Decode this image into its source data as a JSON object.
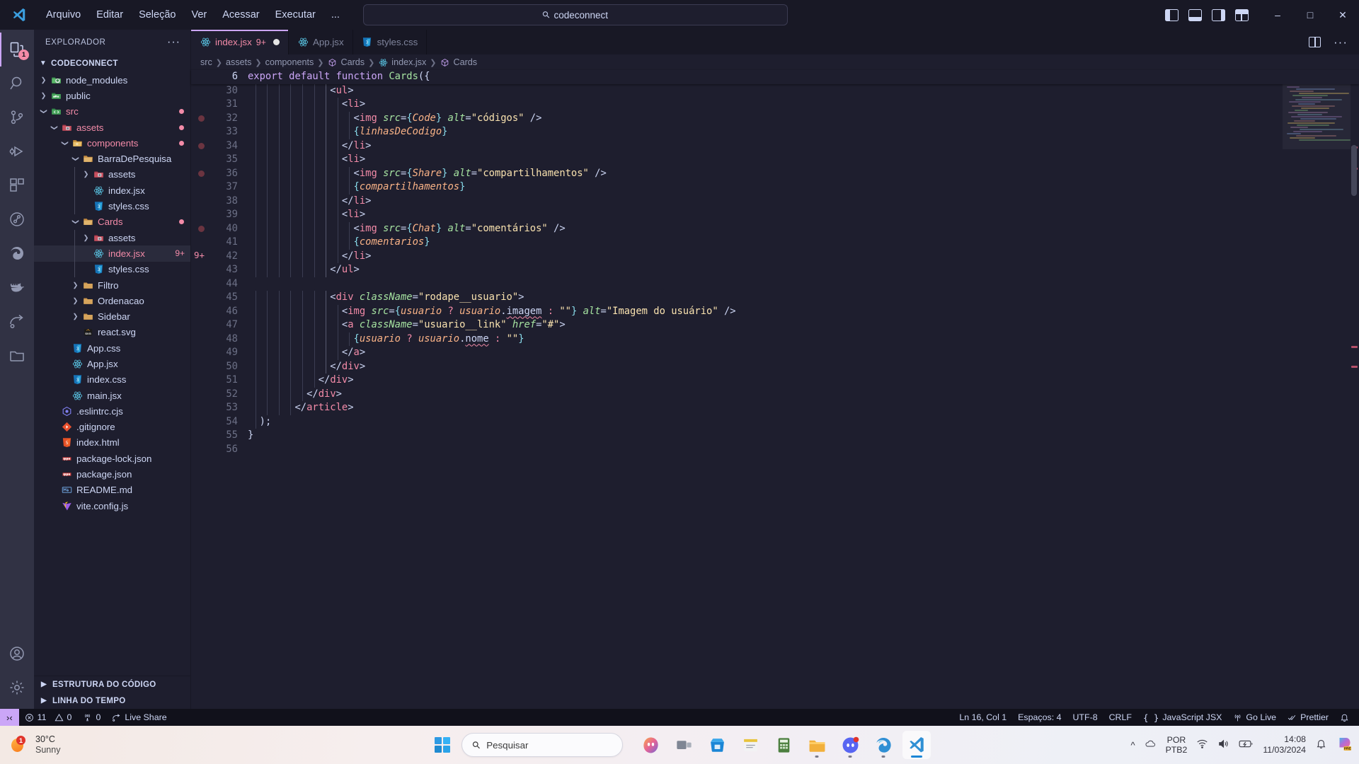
{
  "titlebar": {
    "menu": [
      "Arquivo",
      "Editar",
      "Seleção",
      "Ver",
      "Acessar",
      "Executar",
      "..."
    ],
    "search_value": "codeconnect",
    "back_icon": "arrow-left-icon",
    "forward_icon": "arrow-right-icon",
    "layout_icons": [
      "panel-left-icon",
      "panel-bottom-icon",
      "panel-right-icon",
      "customize-layout-icon"
    ],
    "window_controls": [
      "minimize",
      "maximize",
      "close"
    ]
  },
  "activitybar": {
    "items": [
      {
        "name": "explorer",
        "icon": "files-icon",
        "badge": "1",
        "active": true
      },
      {
        "name": "search",
        "icon": "search-icon",
        "badge": "",
        "active": false
      },
      {
        "name": "source-control",
        "icon": "source-control-icon",
        "badge": "",
        "active": false
      },
      {
        "name": "run-and-debug",
        "icon": "debug-icon",
        "badge": "",
        "active": false
      },
      {
        "name": "extensions",
        "icon": "extensions-icon",
        "badge": "",
        "active": false
      },
      {
        "name": "test-explorer",
        "icon": "beaker-icon",
        "badge": "",
        "active": false
      },
      {
        "name": "edge-tools",
        "icon": "edge-icon",
        "badge": "",
        "active": false
      },
      {
        "name": "docker",
        "icon": "docker-icon",
        "badge": "",
        "active": false
      },
      {
        "name": "live-share",
        "icon": "live-share-icon",
        "badge": "",
        "active": false
      },
      {
        "name": "remote-explorer",
        "icon": "remote-folder-icon",
        "badge": "",
        "active": false
      }
    ],
    "bottom": [
      {
        "name": "accounts",
        "icon": "account-icon"
      },
      {
        "name": "settings",
        "icon": "gear-icon"
      }
    ]
  },
  "sidebar": {
    "title": "EXPLORADOR",
    "more_actions": "···",
    "project": "CODECONNECT",
    "tree": [
      {
        "label": "node_modules",
        "indent": 1,
        "arrow": "collapsed",
        "icon": "folder-node",
        "color": "white",
        "badge": ""
      },
      {
        "label": "public",
        "indent": 1,
        "arrow": "collapsed",
        "icon": "folder-public",
        "color": "white",
        "badge": ""
      },
      {
        "label": "src",
        "indent": 1,
        "arrow": "expanded",
        "icon": "folder-src",
        "color": "red",
        "badge": "dot"
      },
      {
        "label": "assets",
        "indent": 2,
        "arrow": "expanded",
        "icon": "folder-assets",
        "color": "red",
        "badge": "dot"
      },
      {
        "label": "components",
        "indent": 3,
        "arrow": "expanded",
        "icon": "folder-components",
        "color": "red",
        "badge": "dot"
      },
      {
        "label": "BarraDePesquisa",
        "indent": 4,
        "arrow": "expanded",
        "icon": "folder-open",
        "color": "white",
        "badge": ""
      },
      {
        "label": "assets",
        "indent": 5,
        "arrow": "collapsed",
        "icon": "folder-assets",
        "color": "white",
        "badge": ""
      },
      {
        "label": "index.jsx",
        "indent": 5,
        "arrow": "none",
        "icon": "react-icon",
        "color": "white",
        "badge": ""
      },
      {
        "label": "styles.css",
        "indent": 5,
        "arrow": "none",
        "icon": "css-icon",
        "color": "white",
        "badge": ""
      },
      {
        "label": "Cards",
        "indent": 4,
        "arrow": "expanded",
        "icon": "folder-open",
        "color": "red",
        "badge": "dot"
      },
      {
        "label": "assets",
        "indent": 5,
        "arrow": "collapsed",
        "icon": "folder-assets",
        "color": "white",
        "badge": ""
      },
      {
        "label": "index.jsx",
        "indent": 5,
        "arrow": "none",
        "icon": "react-icon",
        "color": "red",
        "badge": "9+",
        "selected": true
      },
      {
        "label": "styles.css",
        "indent": 5,
        "arrow": "none",
        "icon": "css-icon",
        "color": "white",
        "badge": ""
      },
      {
        "label": "Filtro",
        "indent": 4,
        "arrow": "collapsed",
        "icon": "folder-closed",
        "color": "white",
        "badge": ""
      },
      {
        "label": "Ordenacao",
        "indent": 4,
        "arrow": "collapsed",
        "icon": "folder-closed",
        "color": "white",
        "badge": ""
      },
      {
        "label": "Sidebar",
        "indent": 4,
        "arrow": "collapsed",
        "icon": "folder-closed",
        "color": "white",
        "badge": ""
      },
      {
        "label": "react.svg",
        "indent": 4,
        "arrow": "none",
        "icon": "svg-icon",
        "color": "white",
        "badge": ""
      },
      {
        "label": "App.css",
        "indent": 3,
        "arrow": "none",
        "icon": "css-icon",
        "color": "white",
        "badge": ""
      },
      {
        "label": "App.jsx",
        "indent": 3,
        "arrow": "none",
        "icon": "react-icon",
        "color": "white",
        "badge": ""
      },
      {
        "label": "index.css",
        "indent": 3,
        "arrow": "none",
        "icon": "css-icon",
        "color": "white",
        "badge": ""
      },
      {
        "label": "main.jsx",
        "indent": 3,
        "arrow": "none",
        "icon": "react-icon",
        "color": "white",
        "badge": ""
      },
      {
        "label": ".eslintrc.cjs",
        "indent": 2,
        "arrow": "none",
        "icon": "eslint-icon",
        "color": "white",
        "badge": ""
      },
      {
        "label": ".gitignore",
        "indent": 2,
        "arrow": "none",
        "icon": "git-icon",
        "color": "white",
        "badge": ""
      },
      {
        "label": "index.html",
        "indent": 2,
        "arrow": "none",
        "icon": "html-icon",
        "color": "white",
        "badge": ""
      },
      {
        "label": "package-lock.json",
        "indent": 2,
        "arrow": "none",
        "icon": "npm-icon",
        "color": "white",
        "badge": ""
      },
      {
        "label": "package.json",
        "indent": 2,
        "arrow": "none",
        "icon": "npm-icon",
        "color": "white",
        "badge": ""
      },
      {
        "label": "README.md",
        "indent": 2,
        "arrow": "none",
        "icon": "markdown-icon",
        "color": "white",
        "badge": ""
      },
      {
        "label": "vite.config.js",
        "indent": 2,
        "arrow": "none",
        "icon": "vite-icon",
        "color": "white",
        "badge": ""
      }
    ],
    "footer_sections": [
      "ESTRUTURA DO CÓDIGO",
      "LINHA DO TEMPO"
    ]
  },
  "tabs": [
    {
      "label": "index.jsx",
      "icon": "react-icon",
      "badge": "9+",
      "dirty": true,
      "active": true
    },
    {
      "label": "App.jsx",
      "icon": "react-icon",
      "badge": "",
      "dirty": false,
      "active": false
    },
    {
      "label": "styles.css",
      "icon": "css-icon",
      "badge": "",
      "dirty": false,
      "active": false
    }
  ],
  "editor_actions": [
    "split-editor-icon",
    "more-actions-icon"
  ],
  "breadcrumb": [
    "src",
    "assets",
    "components",
    "Cards",
    "index.jsx",
    "Cards"
  ],
  "breadcrumb_icons": {
    "index.jsx": "react-icon",
    "Cards": "symbol-class-icon"
  },
  "sticky_scroll": {
    "line": "6",
    "text": "export default function Cards({"
  },
  "code": {
    "first_line": 30,
    "lines": [
      "              <ul>",
      "                <li>",
      "                  <img src={Code} alt=\"códigos\" />",
      "                  {linhasDeCodigo}",
      "                </li>",
      "                <li>",
      "                  <img src={Share} alt=\"compartilhamentos\" />",
      "                  {compartilhamentos}",
      "                </li>",
      "                <li>",
      "                  <img src={Chat} alt=\"comentários\" />",
      "                  {comentarios}",
      "                </li>",
      "              </ul>",
      "",
      "              <div className=\"rodape__usuario\">",
      "                <img src={usuario ? usuario.imagem : \"\"} alt=\"Imagem do usuário\" />",
      "                <a className=\"usuario__link\" href=\"#\">",
      "                  {usuario ? usuario.nome : \"\"}",
      "                </a>",
      "              </div>",
      "            </div>",
      "          </div>",
      "        </article>",
      "  );",
      "}",
      ""
    ],
    "gutter_badge": {
      "line": 42,
      "text": "9+"
    },
    "breakpoint_dot_lines": [
      32,
      34,
      36,
      40
    ]
  },
  "statusbar": {
    "remote_icon": "remote-window-icon",
    "left": [
      {
        "name": "errors",
        "icon": "error-icon",
        "value": "11"
      },
      {
        "name": "warnings",
        "icon": "warning-icon",
        "value": "0"
      },
      {
        "name": "ports",
        "icon": "radio-tower-icon",
        "value": "0"
      },
      {
        "name": "live-share",
        "icon": "live-share-icon",
        "value": "Live Share"
      }
    ],
    "right": [
      {
        "name": "cursor-position",
        "value": "Ln 16, Col 1"
      },
      {
        "name": "indentation",
        "value": "Espaços: 4"
      },
      {
        "name": "encoding",
        "value": "UTF-8"
      },
      {
        "name": "eol",
        "value": "CRLF"
      },
      {
        "name": "language-mode",
        "icon": "braces-icon",
        "value": "JavaScript JSX"
      },
      {
        "name": "go-live",
        "icon": "broadcast-icon",
        "value": "Go Live"
      },
      {
        "name": "prettier",
        "icon": "check-check-icon",
        "value": "Prettier"
      },
      {
        "name": "notifications",
        "icon": "bell-icon",
        "value": ""
      }
    ]
  },
  "taskbar": {
    "weather": {
      "temp": "30°C",
      "condition": "Sunny",
      "badge": "1",
      "icon": "sun-icon"
    },
    "start_icon": "windows-logo-icon",
    "search_placeholder": "Pesquisar",
    "search_icon": "search-icon",
    "apps": [
      {
        "name": "copilot",
        "icon": "copilot-icon",
        "running": false,
        "active": false
      },
      {
        "name": "task-view",
        "icon": "task-view-icon",
        "running": false,
        "active": false
      },
      {
        "name": "microsoft-store",
        "icon": "store-icon",
        "running": false,
        "active": false
      },
      {
        "name": "sticky-notes",
        "icon": "notes-icon",
        "running": false,
        "active": false
      },
      {
        "name": "calculator",
        "icon": "calculator-icon",
        "running": false,
        "active": false
      },
      {
        "name": "file-explorer",
        "icon": "folder-icon",
        "running": true,
        "active": false
      },
      {
        "name": "discord",
        "icon": "discord-icon",
        "running": true,
        "active": false
      },
      {
        "name": "microsoft-edge",
        "icon": "edge-icon",
        "running": true,
        "active": false
      },
      {
        "name": "visual-studio-code",
        "icon": "vscode-icon",
        "running": true,
        "active": true
      }
    ],
    "tray": {
      "chevron": "chevron-up-icon",
      "cloud_icon": "onedrive-icon",
      "language_line1": "POR",
      "language_line2": "PTB2",
      "wifi_icon": "wifi-icon",
      "volume_icon": "volume-icon",
      "battery_icon": "battery-charging-icon",
      "time": "14:08",
      "date": "11/03/2024",
      "notification_icon": "bell-dnd-icon",
      "copilot_icon": "copilot-pre-icon"
    }
  },
  "colors": {
    "accent": "#cba6f7",
    "error": "#f38ba8",
    "bg_editor": "#1e1e2e",
    "bg_sidebar": "#1e1e2e",
    "bg_activitybar": "#313244",
    "bg_statusbar": "#11111b"
  }
}
